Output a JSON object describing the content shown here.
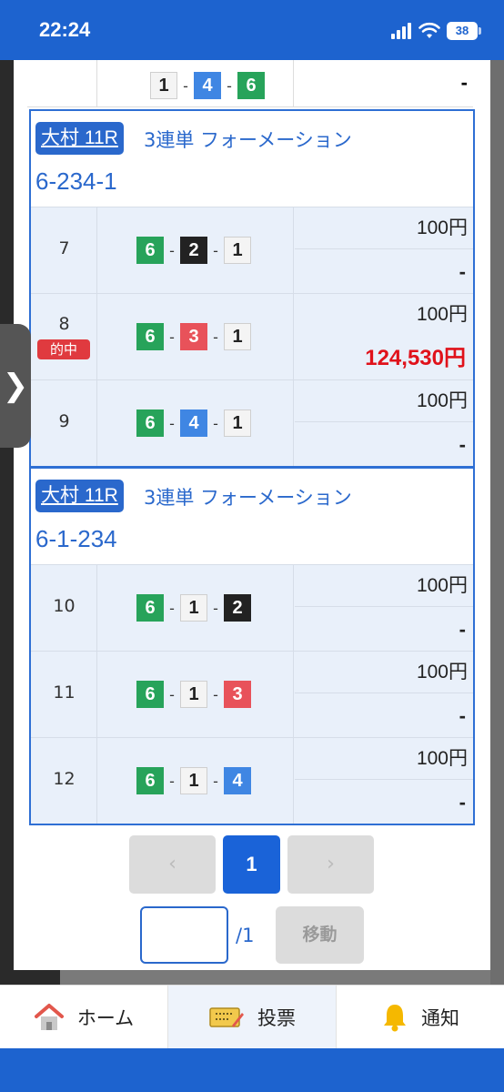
{
  "status": {
    "time": "22:24",
    "battery": "38"
  },
  "top_row": {
    "combo": [
      "1",
      "4",
      "6"
    ],
    "payout": "-"
  },
  "groups": [
    {
      "venue": "大村 11R",
      "bet_type": "3連単 フォーメーション",
      "formation": "6-234-1",
      "rows": [
        {
          "num": "7",
          "combo": [
            "6",
            "2",
            "1"
          ],
          "amount": "100円",
          "payout": "-"
        },
        {
          "num": "8",
          "badge": "的中",
          "combo": [
            "6",
            "3",
            "1"
          ],
          "amount": "100円",
          "payout": "124,530円"
        },
        {
          "num": "9",
          "combo": [
            "6",
            "4",
            "1"
          ],
          "amount": "100円",
          "payout": "-"
        }
      ]
    },
    {
      "venue": "大村 11R",
      "bet_type": "3連単 フォーメーション",
      "formation": "6-1-234",
      "rows": [
        {
          "num": "10",
          "combo": [
            "6",
            "1",
            "2"
          ],
          "amount": "100円",
          "payout": "-"
        },
        {
          "num": "11",
          "combo": [
            "6",
            "1",
            "3"
          ],
          "amount": "100円",
          "payout": "-"
        },
        {
          "num": "12",
          "combo": [
            "6",
            "1",
            "4"
          ],
          "amount": "100円",
          "payout": "-"
        }
      ]
    }
  ],
  "pagination": {
    "prev": "‹",
    "current": "1",
    "next": "›",
    "total": "/1",
    "move": "移動",
    "input_value": ""
  },
  "tabbar": {
    "home": "ホーム",
    "vote": "投票",
    "notify": "通知"
  },
  "colors": {
    "accent": "#1d63cf",
    "hit": "#e0121b",
    "boat1": "#f4f4f4",
    "boat2": "#222222",
    "boat3": "#e8525a",
    "boat4": "#3f86e3",
    "boat6": "#27a35a"
  },
  "icons": {
    "side": "chevron-right-icon",
    "home": "home-icon",
    "vote": "ticket-pen-icon",
    "notify": "bell-icon"
  }
}
